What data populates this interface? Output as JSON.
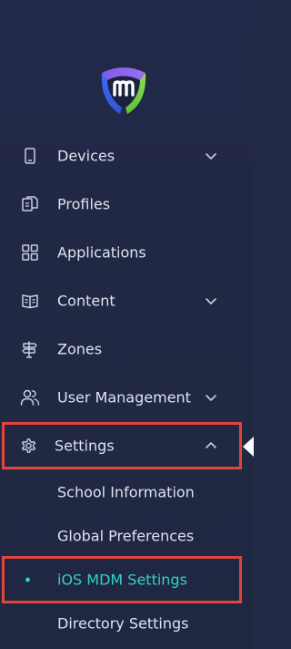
{
  "brand": {
    "logo_letter": "m"
  },
  "nav": {
    "devices": "Devices",
    "profiles": "Profiles",
    "applications": "Applications",
    "content": "Content",
    "zones": "Zones",
    "user_management": "User Management",
    "settings": "Settings"
  },
  "settings_submenu": {
    "school_information": "School Information",
    "global_preferences": "Global Preferences",
    "ios_mdm_settings": "iOS MDM Settings",
    "directory_settings": "Directory Settings"
  },
  "colors": {
    "background": "#222a45",
    "text": "#dfe3ef",
    "active": "#33d0c8",
    "highlight": "#e0453d"
  }
}
